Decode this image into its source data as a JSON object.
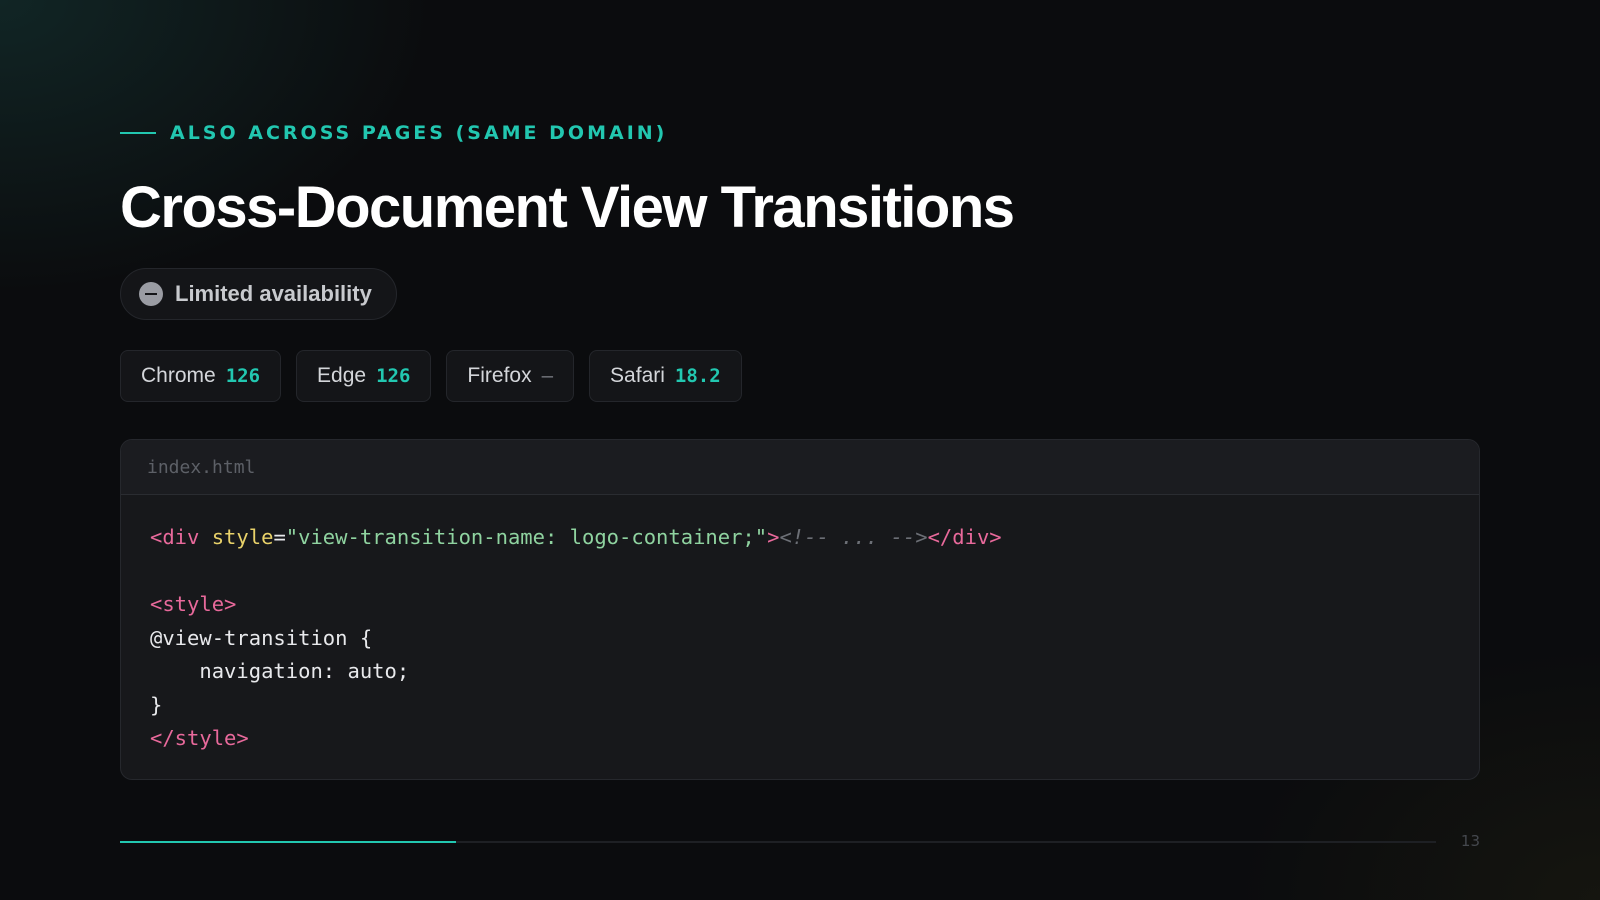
{
  "slide": {
    "kicker": "ALSO ACROSS PAGES (SAME DOMAIN)",
    "title": "Cross-Document View Transitions",
    "availability": {
      "icon": "minus-circle-icon",
      "label": "Limited availability"
    },
    "browsers": [
      {
        "name": "Chrome",
        "version": "126"
      },
      {
        "name": "Edge",
        "version": "126"
      },
      {
        "name": "Firefox",
        "version": "–"
      },
      {
        "name": "Safari",
        "version": "18.2"
      }
    ],
    "code": {
      "filename": "index.html",
      "line1": {
        "open_tag": "<div",
        "space": " ",
        "attr": "style",
        "eq": "=",
        "value": "\"view-transition-name: logo-container;\"",
        "close_bracket": ">",
        "comment": "<!-- ... -->",
        "end_tag": "</div>"
      },
      "line3": "<style>",
      "line4": "@view-transition {",
      "line5": "    navigation: auto;",
      "line6": "}",
      "line7": "</style>"
    },
    "progress": 0.255,
    "page_number": "13"
  },
  "colors": {
    "accent": "#22c7b0",
    "background": "#0b0c0e",
    "tag": "#e8699b",
    "attribute": "#e9d26a",
    "string": "#8fd3a0"
  }
}
